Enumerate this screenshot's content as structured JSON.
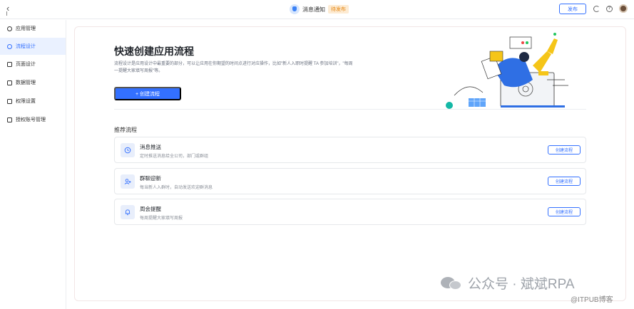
{
  "header": {
    "back_icon": "chevron-left-icon",
    "app_icon": "cup-icon",
    "title": "消息通知",
    "status_badge": "待发布",
    "publish_label": "发布",
    "icons": [
      "refresh-icon",
      "help-icon",
      "user-avatar"
    ]
  },
  "sidebar": {
    "items": [
      {
        "label": "应用管理",
        "icon": "gear-icon"
      },
      {
        "label": "流程设计",
        "icon": "person-icon",
        "active": true
      },
      {
        "label": "页面设计",
        "icon": "page-icon"
      },
      {
        "label": "数据管理",
        "icon": "database-icon"
      },
      {
        "label": "权限设置",
        "icon": "lock-icon"
      },
      {
        "label": "授权账号管理",
        "icon": "account-icon"
      }
    ]
  },
  "hero": {
    "title": "快速创建应用流程",
    "description": "流程设计是应用设计中最重要的部分，可以让应用在你期望的时间点进行对应操作，比如\"新人入职时提醒 TA 参加培训\"，\"每周一提醒大家填写周报\"等。",
    "create_button": "+ 创建流程"
  },
  "recommended": {
    "title": "推荐流程",
    "cards": [
      {
        "name": "消息推送",
        "desc": "定时推送消息给全公司，部门或群组",
        "button": "创建流程",
        "icon": "clock-icon"
      },
      {
        "name": "群聊迎新",
        "desc": "每当新人入群时，自动发送欢迎群消息",
        "button": "创建流程",
        "icon": "group-add-icon"
      },
      {
        "name": "周会提醒",
        "desc": "每周提醒大家填写周报",
        "button": "创建流程",
        "icon": "bell-icon"
      }
    ]
  },
  "watermark": {
    "text": "公众号 · 斌斌RPA",
    "sub": "@ITPUB博客"
  },
  "colors": {
    "accent": "#3370ff",
    "badge_bg": "#fdebd3",
    "badge_text": "#e5850f",
    "active_bg": "#eaf1ff"
  }
}
